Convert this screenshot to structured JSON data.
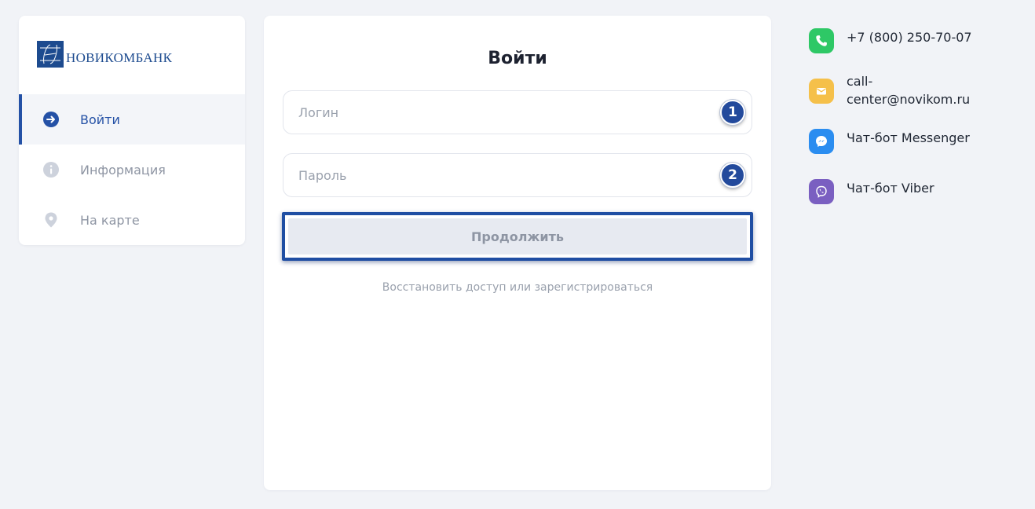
{
  "brand": {
    "name": "НОВИКОМБАНК",
    "logo_icon": "novikombank-monogram-icon",
    "color": "#1d4b8f"
  },
  "sidebar": {
    "items": [
      {
        "label": "Войти",
        "icon": "arrow-right-circle-icon",
        "active": true
      },
      {
        "label": "Информация",
        "icon": "info-circle-icon",
        "active": false
      },
      {
        "label": "На карте",
        "icon": "map-pin-icon",
        "active": false
      }
    ]
  },
  "login": {
    "title": "Войти",
    "login_field": {
      "placeholder": "Логин",
      "value": "",
      "badge": "1"
    },
    "password_field": {
      "placeholder": "Пароль",
      "value": "",
      "badge": "2"
    },
    "continue_label": "Продолжить",
    "restore_link": "Восстановить доступ или зарегистрироваться"
  },
  "contacts": {
    "phone": {
      "icon": "phone-icon",
      "color": "#2ec866",
      "lines": [
        "+7 (800) 250-70-07"
      ]
    },
    "email": {
      "icon": "mail-icon",
      "color": "#f5c04a",
      "lines": [
        "call-",
        "center@novikom.ru"
      ]
    },
    "messenger": {
      "icon": "messenger-icon",
      "color": "#2b8df0",
      "lines": [
        "Чат-бот Messenger"
      ]
    },
    "viber": {
      "icon": "viber-icon",
      "color": "#7a5fc1",
      "lines": [
        "Чат-бот Viber"
      ]
    }
  },
  "colors": {
    "accent": "#2451a6",
    "highlight_frame": "#1f4ea3",
    "page_background": "#f1f3f7"
  }
}
